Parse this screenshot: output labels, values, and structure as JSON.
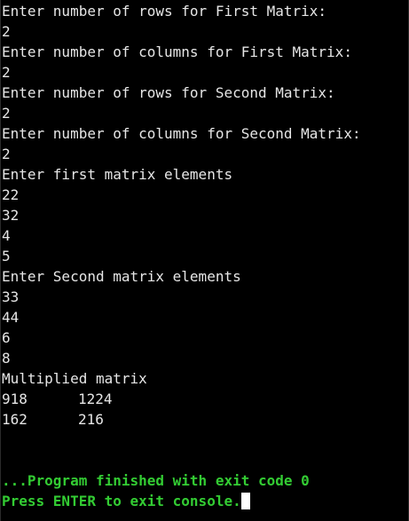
{
  "lines": [
    "Enter number of rows for First Matrix:",
    "2",
    "Enter number of columns for First Matrix:",
    "2",
    "Enter number of rows for Second Matrix:",
    "2",
    "Enter number of columns for Second Matrix:",
    "2",
    "Enter first matrix elements",
    "22",
    "32",
    "4",
    "5",
    "Enter Second matrix elements",
    "33",
    "44",
    "6",
    "8",
    "Multiplied matrix"
  ],
  "result_matrix": [
    [
      "918",
      "1224"
    ],
    [
      "162",
      "216"
    ]
  ],
  "status": {
    "finished": "...Program finished with exit code 0",
    "prompt": "Press ENTER to exit console."
  },
  "colors": {
    "background": "#000000",
    "text": "#e6e6e6",
    "status": "#33cc33",
    "cursor": "#ffffff"
  }
}
